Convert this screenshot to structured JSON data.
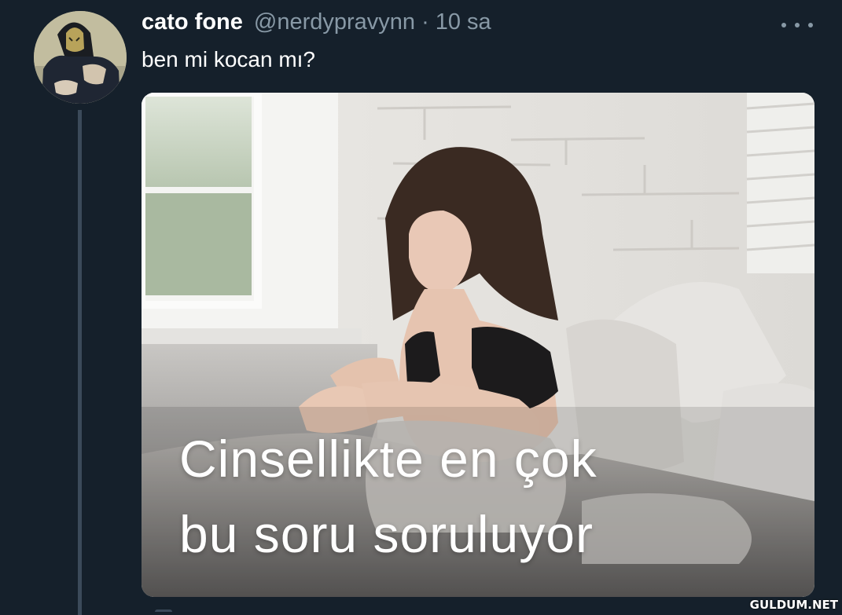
{
  "tweet": {
    "display_name": "cato fone",
    "handle": "@nerdypravynn",
    "separator": "·",
    "time": "10 sa",
    "text": "ben mi kocan mı?",
    "avatar_icon": "user-avatar",
    "more_icon": "more-options-icon"
  },
  "media": {
    "caption_line1": "Cinsellikte en çok",
    "caption_line2": "bu soru soruluyor"
  },
  "watermark": {
    "text": "GULDUM.NET"
  },
  "colors": {
    "background": "#15202b",
    "secondary_text": "#8899a6",
    "thread_line": "#3b4a5a"
  }
}
